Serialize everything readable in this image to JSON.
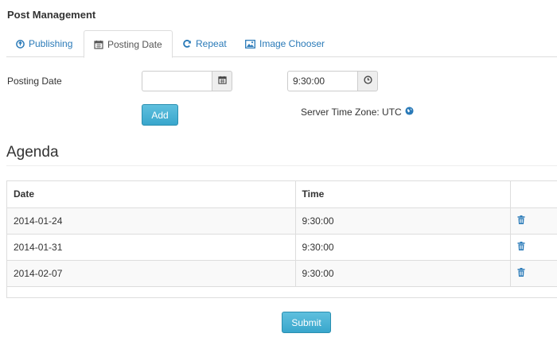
{
  "page": {
    "title": "Post Management"
  },
  "tabs": [
    {
      "label": "Publishing",
      "icon": "arrow-circle-icon",
      "active": false
    },
    {
      "label": "Posting Date",
      "icon": "calendar-icon",
      "active": true
    },
    {
      "label": "Repeat",
      "icon": "refresh-icon",
      "active": false
    },
    {
      "label": "Image Chooser",
      "icon": "image-icon",
      "active": false
    }
  ],
  "form": {
    "posting_date_label": "Posting Date",
    "date_value": "",
    "time_value": "9:30:00",
    "add_label": "Add",
    "timezone_text": "Server Time Zone: UTC"
  },
  "agenda": {
    "title": "Agenda",
    "columns": [
      "Date",
      "Time",
      ""
    ],
    "rows": [
      {
        "date": "2014-01-24",
        "time": "9:30:00"
      },
      {
        "date": "2014-01-31",
        "time": "9:30:00"
      },
      {
        "date": "2014-02-07",
        "time": "9:30:00"
      }
    ]
  },
  "submit_label": "Submit",
  "colors": {
    "link": "#2a7ab8",
    "button": "#39a6cc",
    "border": "#dddddd"
  }
}
